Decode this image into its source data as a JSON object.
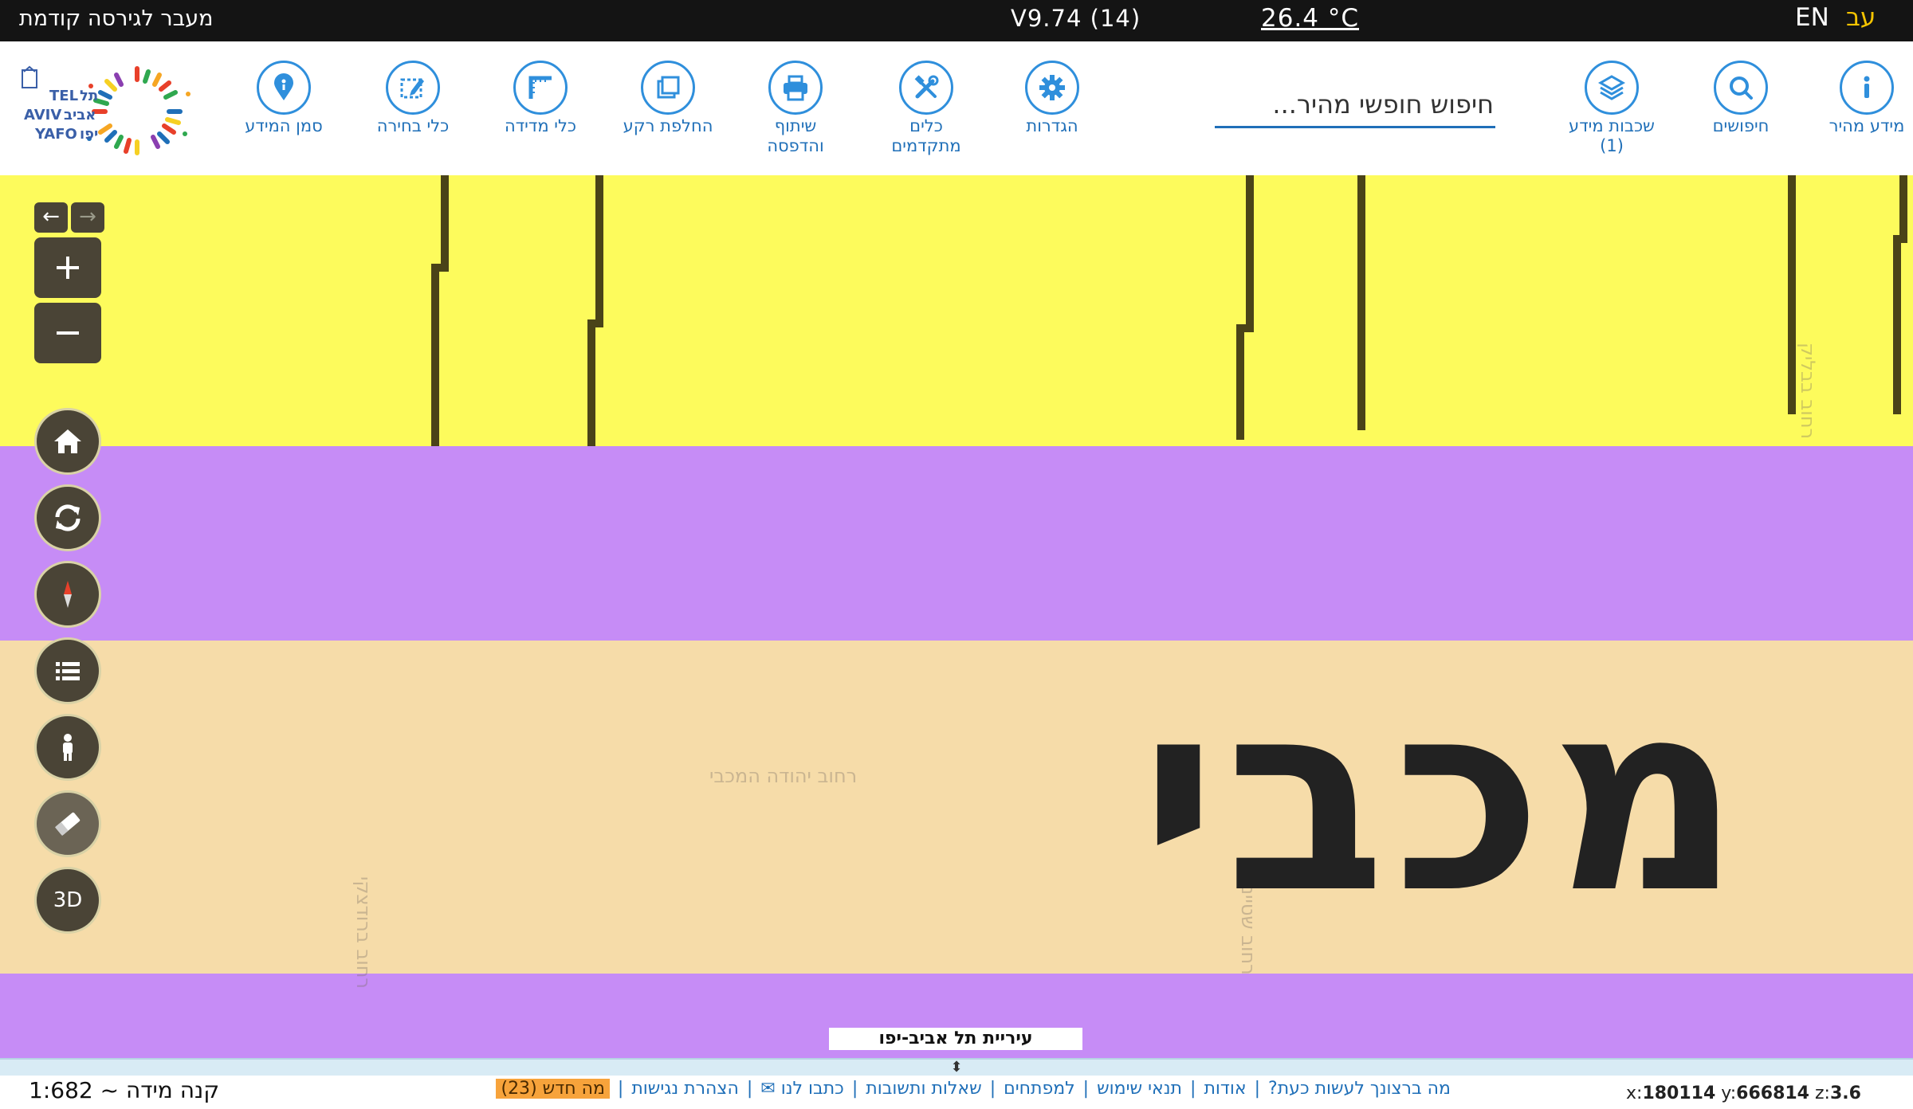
{
  "topbar": {
    "previous_version": "מעבר לגירסה קודמת",
    "version": "V9.74 (14)",
    "temperature": "26.4 °C",
    "lang_en": "EN",
    "lang_he": "עב"
  },
  "toolbar": {
    "tools": [
      {
        "id": "quick-info",
        "label": "מידע מהיר",
        "label2": "",
        "icon": "info-icon"
      },
      {
        "id": "searches",
        "label": "חיפושים",
        "label2": "",
        "icon": "search-icon"
      },
      {
        "id": "info-layers",
        "label": "שכבות מידע",
        "label2": "(1)",
        "icon": "layers-icon"
      },
      {
        "id": "settings",
        "label": "הגדרות",
        "label2": "",
        "icon": "gear-icon"
      },
      {
        "id": "advanced-tools",
        "label": "כלים",
        "label2": "מתקדמים",
        "icon": "tools-icon"
      },
      {
        "id": "share-print",
        "label": "שיתוף",
        "label2": "והדפסה",
        "icon": "printer-icon"
      },
      {
        "id": "switch-background",
        "label": "החלפת רקע",
        "label2": "",
        "icon": "background-icon"
      },
      {
        "id": "measure-tools",
        "label": "כלי מדידה",
        "label2": "",
        "icon": "ruler-icon"
      },
      {
        "id": "selection-tools",
        "label": "כלי בחירה",
        "label2": "",
        "icon": "selection-icon"
      },
      {
        "id": "info-marker",
        "label": "סמן המידע",
        "label2": "",
        "icon": "pin-icon"
      }
    ],
    "search_placeholder": "חיפוש חופשי מהיר...",
    "logo_lines": [
      "TEL",
      "תל",
      "AVIV",
      "אביב",
      "YAFO",
      "יפו"
    ]
  },
  "map": {
    "street_labels": [
      "רחוב יהודה המכבי",
      "רחוב ברודצקי",
      "רחוב שטיינר",
      "רחוב בבליק"
    ],
    "big_label": "מכבי",
    "municipality": "עיריית תל אביב-יפו",
    "controls": [
      "arrow-back",
      "arrow-forward",
      "zoom-in",
      "zoom-out",
      "home",
      "refresh",
      "compass",
      "legend",
      "street-view",
      "eraser",
      "3d"
    ],
    "btn_3d": "3D",
    "colors": {
      "yellow": "#fdfb5c",
      "purple": "#c68cf6",
      "beige": "#f6dca9",
      "control": "#4a4436"
    }
  },
  "bottom": {
    "scale": "קנה מידה ~ 1:682",
    "links": [
      {
        "text": "מה ברצונך לעשות כעת?"
      },
      {
        "text": "אודות"
      },
      {
        "text": "תנאי שימוש"
      },
      {
        "text": "למפתחים"
      },
      {
        "text": "שאלות ותשובות"
      },
      {
        "text": "כתבו לנו ✉"
      },
      {
        "text": "הצהרת נגישות"
      }
    ],
    "whats_new": "מה חדש (23)",
    "coords": {
      "x_label": "x:",
      "x": "180114",
      "y_label": "y:",
      "y": "666814",
      "z_label": "z:",
      "z": "3.6"
    }
  }
}
